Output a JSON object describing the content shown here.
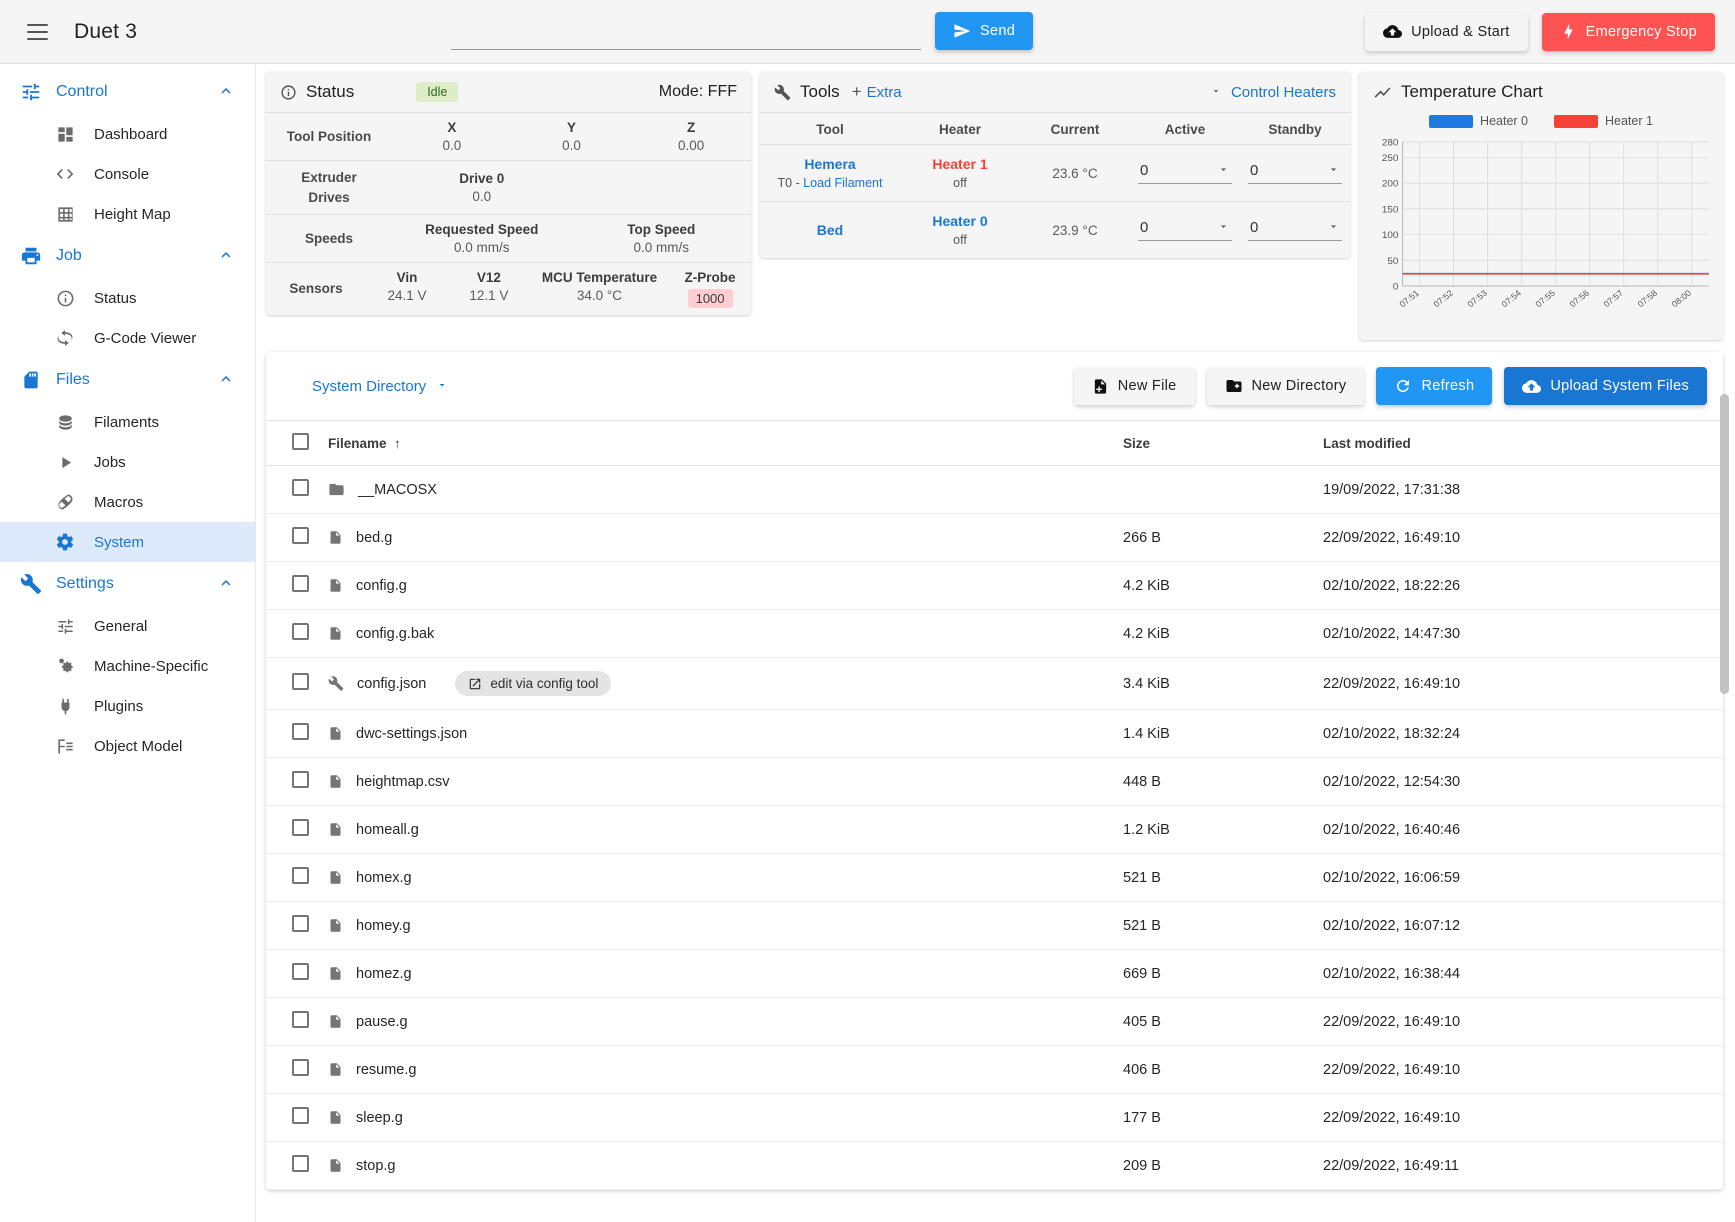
{
  "topbar": {
    "menu_icon": "hamburger-icon",
    "title": "Duet 3",
    "gcode_placeholder": "",
    "gcode_value": "",
    "send_label": "Send",
    "send_icon": "send-icon",
    "upload_start_label": "Upload & Start",
    "upload_start_icon": "cloud-upload-icon",
    "emergency_label": "Emergency Stop",
    "emergency_icon": "lightning-bolt-icon",
    "accent_blue": "#2196f3",
    "danger_red": "#ff5252"
  },
  "sidebar": {
    "groups": [
      {
        "label": "Control",
        "icon": "sliders-icon",
        "chevron": "chevron-up-icon",
        "items": [
          {
            "label": "Dashboard",
            "icon": "dashboard-icon",
            "active": false
          },
          {
            "label": "Console",
            "icon": "code-brackets-icon",
            "active": false
          },
          {
            "label": "Height Map",
            "icon": "grid-icon",
            "active": false
          }
        ]
      },
      {
        "label": "Job",
        "icon": "printer-icon",
        "chevron": "chevron-up-icon",
        "items": [
          {
            "label": "Status",
            "icon": "info-circle-icon",
            "active": false
          },
          {
            "label": "G-Code Viewer",
            "icon": "rotate-3d-icon",
            "active": false
          }
        ]
      },
      {
        "label": "Files",
        "icon": "sd-card-icon",
        "chevron": "chevron-up-icon",
        "items": [
          {
            "label": "Filaments",
            "icon": "layers-icon",
            "active": false
          },
          {
            "label": "Jobs",
            "icon": "play-icon",
            "active": false
          },
          {
            "label": "Macros",
            "icon": "macro-icon",
            "active": false
          },
          {
            "label": "System",
            "icon": "gear-icon",
            "active": true
          }
        ]
      },
      {
        "label": "Settings",
        "icon": "wrench-icon",
        "chevron": "chevron-up-icon",
        "items": [
          {
            "label": "General",
            "icon": "sliders-icon",
            "active": false
          },
          {
            "label": "Machine-Specific",
            "icon": "gears-icon",
            "active": false
          },
          {
            "label": "Plugins",
            "icon": "plug-icon",
            "active": false
          },
          {
            "label": "Object Model",
            "icon": "tree-list-icon",
            "active": false
          }
        ]
      }
    ]
  },
  "status_panel": {
    "icon": "info-circle-icon",
    "title": "Status",
    "badge": "Idle",
    "mode": "Mode: FFF",
    "rows": [
      {
        "label": "Tool Position",
        "cells": [
          {
            "k": "X",
            "v": "0.0"
          },
          {
            "k": "Y",
            "v": "0.0"
          },
          {
            "k": "Z",
            "v": "0.00"
          }
        ]
      },
      {
        "label": "Extruder Drives",
        "cells": [
          {
            "k": "Drive 0",
            "v": "0.0"
          }
        ]
      },
      {
        "label": "Speeds",
        "cells": [
          {
            "k": "Requested Speed",
            "v": "0.0 mm/s"
          },
          {
            "k": "Top Speed",
            "v": "0.0 mm/s"
          }
        ]
      },
      {
        "label": "Sensors",
        "cells": [
          {
            "k": "Vin",
            "v": "24.1 V"
          },
          {
            "k": "V12",
            "v": "12.1 V"
          },
          {
            "k": "MCU Temperature",
            "v": "34.0 °C"
          },
          {
            "k": "Z-Probe",
            "v": "1000",
            "badge": true
          }
        ]
      }
    ]
  },
  "tools_panel": {
    "icon": "wrench-icon",
    "title": "Tools",
    "plus": "+",
    "extra_label": "Extra",
    "control_heaters_label": "Control Heaters",
    "caret_icon": "caret-down-icon",
    "headers": [
      "Tool",
      "Heater",
      "Current",
      "Active",
      "Standby"
    ],
    "rows": [
      {
        "tool": "Hemera",
        "tool_sub_prefix": "T0 - ",
        "tool_sub_link": "Load Filament",
        "heater": "Heater 1",
        "heater_color": "red",
        "heater_state": "off",
        "current": "23.6 °C",
        "active": "0",
        "standby": "0"
      },
      {
        "tool": "Bed",
        "tool_sub_prefix": "",
        "tool_sub_link": "",
        "heater": "Heater 0",
        "heater_color": "blue",
        "heater_state": "off",
        "current": "23.9 °C",
        "active": "0",
        "standby": "0"
      }
    ]
  },
  "chart_data": {
    "type": "line",
    "title": "Temperature Chart",
    "icon": "line-chart-icon",
    "xlabel": "",
    "ylabel": "",
    "ylim": [
      0,
      280
    ],
    "yticks": [
      280,
      250,
      200,
      150,
      100,
      50,
      0
    ],
    "xticks": [
      "07:51",
      "07:52",
      "07:53",
      "07:54",
      "07:55",
      "07:56",
      "07:57",
      "07:58",
      "08:00"
    ],
    "grid": true,
    "legend_position": "top",
    "series": [
      {
        "name": "Heater 0",
        "color": "#1f77e0",
        "values": [
          23.9,
          23.9,
          23.9,
          23.9,
          23.9,
          23.9,
          23.9,
          23.9,
          23.9
        ]
      },
      {
        "name": "Heater 1",
        "color": "#f44336",
        "values": [
          23.6,
          23.6,
          23.6,
          23.6,
          23.6,
          23.6,
          23.6,
          23.6,
          23.6
        ]
      }
    ]
  },
  "files_panel": {
    "directory_label": "System Directory",
    "directory_caret": "caret-down-icon",
    "buttons": [
      {
        "label": "New File",
        "icon": "file-plus-icon",
        "style": "light"
      },
      {
        "label": "New Directory",
        "icon": "folder-plus-icon",
        "style": "light"
      },
      {
        "label": "Refresh",
        "icon": "refresh-icon",
        "style": "blue"
      },
      {
        "label": "Upload System Files",
        "icon": "cloud-upload-icon",
        "style": "blue-dark"
      }
    ],
    "columns": [
      "Filename",
      "Size",
      "Last modified"
    ],
    "sort_icon": "arrow-up-icon",
    "rows": [
      {
        "name": "__MACOSX",
        "icon": "folder-icon",
        "size": "",
        "modified": "19/09/2022, 17:31:38",
        "chip": ""
      },
      {
        "name": "bed.g",
        "icon": "file-icon",
        "size": "266 B",
        "modified": "22/09/2022, 16:49:10",
        "chip": ""
      },
      {
        "name": "config.g",
        "icon": "file-icon",
        "size": "4.2 KiB",
        "modified": "02/10/2022, 18:22:26",
        "chip": ""
      },
      {
        "name": "config.g.bak",
        "icon": "file-icon",
        "size": "4.2 KiB",
        "modified": "02/10/2022, 14:47:30",
        "chip": ""
      },
      {
        "name": "config.json",
        "icon": "wrench-icon",
        "size": "3.4 KiB",
        "modified": "22/09/2022, 16:49:10",
        "chip": "edit via config tool"
      },
      {
        "name": "dwc-settings.json",
        "icon": "file-icon",
        "size": "1.4 KiB",
        "modified": "02/10/2022, 18:32:24",
        "chip": ""
      },
      {
        "name": "heightmap.csv",
        "icon": "file-icon",
        "size": "448 B",
        "modified": "02/10/2022, 12:54:30",
        "chip": ""
      },
      {
        "name": "homeall.g",
        "icon": "file-icon",
        "size": "1.2 KiB",
        "modified": "02/10/2022, 16:40:46",
        "chip": ""
      },
      {
        "name": "homex.g",
        "icon": "file-icon",
        "size": "521 B",
        "modified": "02/10/2022, 16:06:59",
        "chip": ""
      },
      {
        "name": "homey.g",
        "icon": "file-icon",
        "size": "521 B",
        "modified": "02/10/2022, 16:07:12",
        "chip": ""
      },
      {
        "name": "homez.g",
        "icon": "file-icon",
        "size": "669 B",
        "modified": "02/10/2022, 16:38:44",
        "chip": ""
      },
      {
        "name": "pause.g",
        "icon": "file-icon",
        "size": "405 B",
        "modified": "22/09/2022, 16:49:10",
        "chip": ""
      },
      {
        "name": "resume.g",
        "icon": "file-icon",
        "size": "406 B",
        "modified": "22/09/2022, 16:49:10",
        "chip": ""
      },
      {
        "name": "sleep.g",
        "icon": "file-icon",
        "size": "177 B",
        "modified": "22/09/2022, 16:49:10",
        "chip": ""
      },
      {
        "name": "stop.g",
        "icon": "file-icon",
        "size": "209 B",
        "modified": "22/09/2022, 16:49:11",
        "chip": ""
      }
    ]
  }
}
